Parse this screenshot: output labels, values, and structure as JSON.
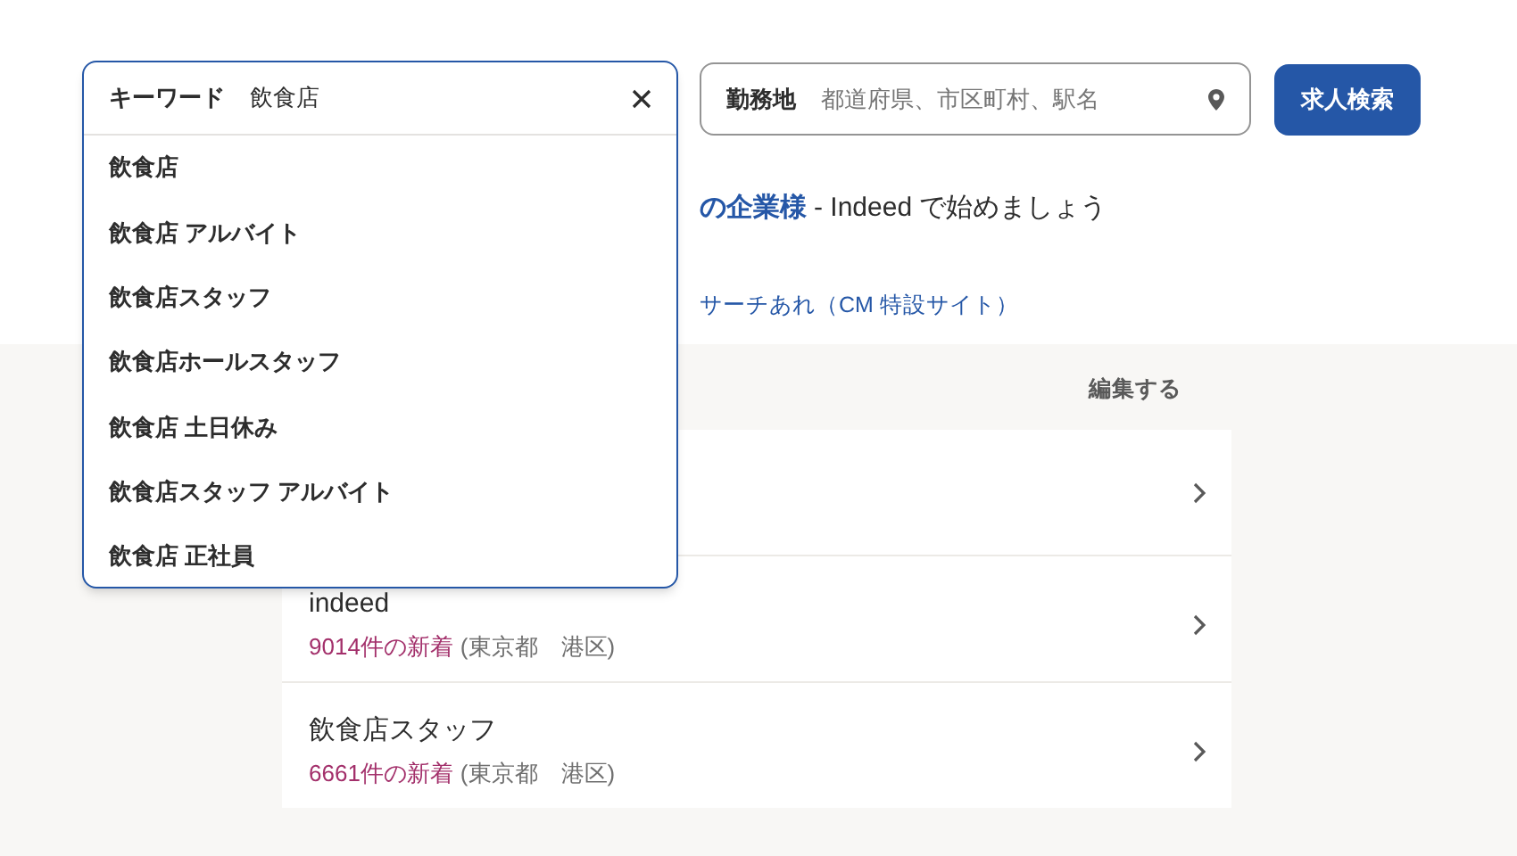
{
  "keyword_field": {
    "label": "キーワード",
    "value": "飲食店"
  },
  "suggestions": [
    {
      "text": "飲食店"
    },
    {
      "text": "飲食店 アルバイト"
    },
    {
      "text": "飲食店スタッフ"
    },
    {
      "text": "飲食店ホールスタッフ"
    },
    {
      "text": "飲食店 土日休み"
    },
    {
      "text": "飲食店スタッフ アルバイト"
    },
    {
      "text": "飲食店 正社員"
    }
  ],
  "location_field": {
    "label": "勤務地",
    "placeholder": "都道府県、市区町村、駅名"
  },
  "search_button": "求人検索",
  "employer_line": {
    "link": "の企業様",
    "text": "- Indeed で始めましょう"
  },
  "campaign_link": "サーチあれ（CM 特設サイト）",
  "saved_searches": {
    "edit": "編集する",
    "items": [
      {
        "kind": "covered"
      },
      {
        "kind": "search",
        "title": "indeed",
        "count": "9014件の新着",
        "location": "(東京都　港区)"
      },
      {
        "kind": "search",
        "title": "飲食店スタッフ",
        "count": "6661件の新着",
        "location": "(東京都　港区)"
      }
    ]
  }
}
